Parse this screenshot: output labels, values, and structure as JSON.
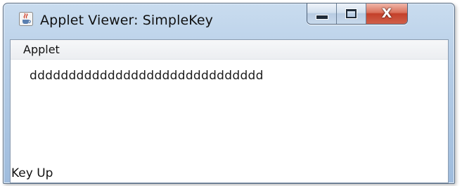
{
  "window": {
    "title": "Applet Viewer: SimpleKey",
    "icon": "java-cup-icon",
    "controls": {
      "minimize_icon": "minimize-icon",
      "maximize_icon": "maximize-icon",
      "close_icon": "close-icon",
      "close_glyph": "X",
      "close_color": "#c3402a"
    }
  },
  "menubar": {
    "items": [
      {
        "label": "Applet"
      }
    ]
  },
  "applet": {
    "typed_text": "dddddddddddddddddddddddddddddd",
    "status": "Key Up"
  }
}
